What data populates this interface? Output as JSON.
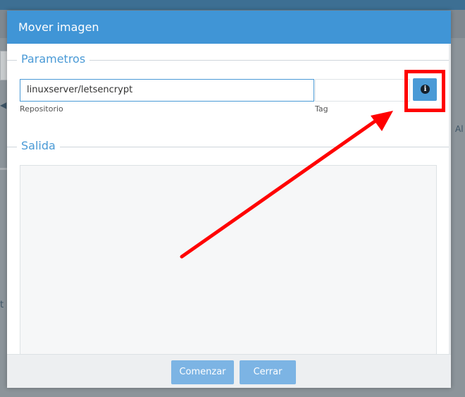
{
  "dialog": {
    "title": "Mover imagen",
    "parameters_legend": "Parametros",
    "repository": {
      "value": "linuxserver/letsencrypt",
      "label": "Repositorio"
    },
    "tag": {
      "value": "",
      "label": "Tag"
    },
    "info_icon_glyph": "i",
    "output_legend": "Salida",
    "buttons": {
      "start": "Comenzar",
      "close": "Cerrar"
    }
  },
  "background": {
    "left_fragment": "t",
    "right_fragment": "Al",
    "arrow_glyph": "◀"
  },
  "annotation": {
    "color": "#ff0000"
  },
  "colors": {
    "accent": "#4095d6",
    "button": "#7cb4e4"
  }
}
